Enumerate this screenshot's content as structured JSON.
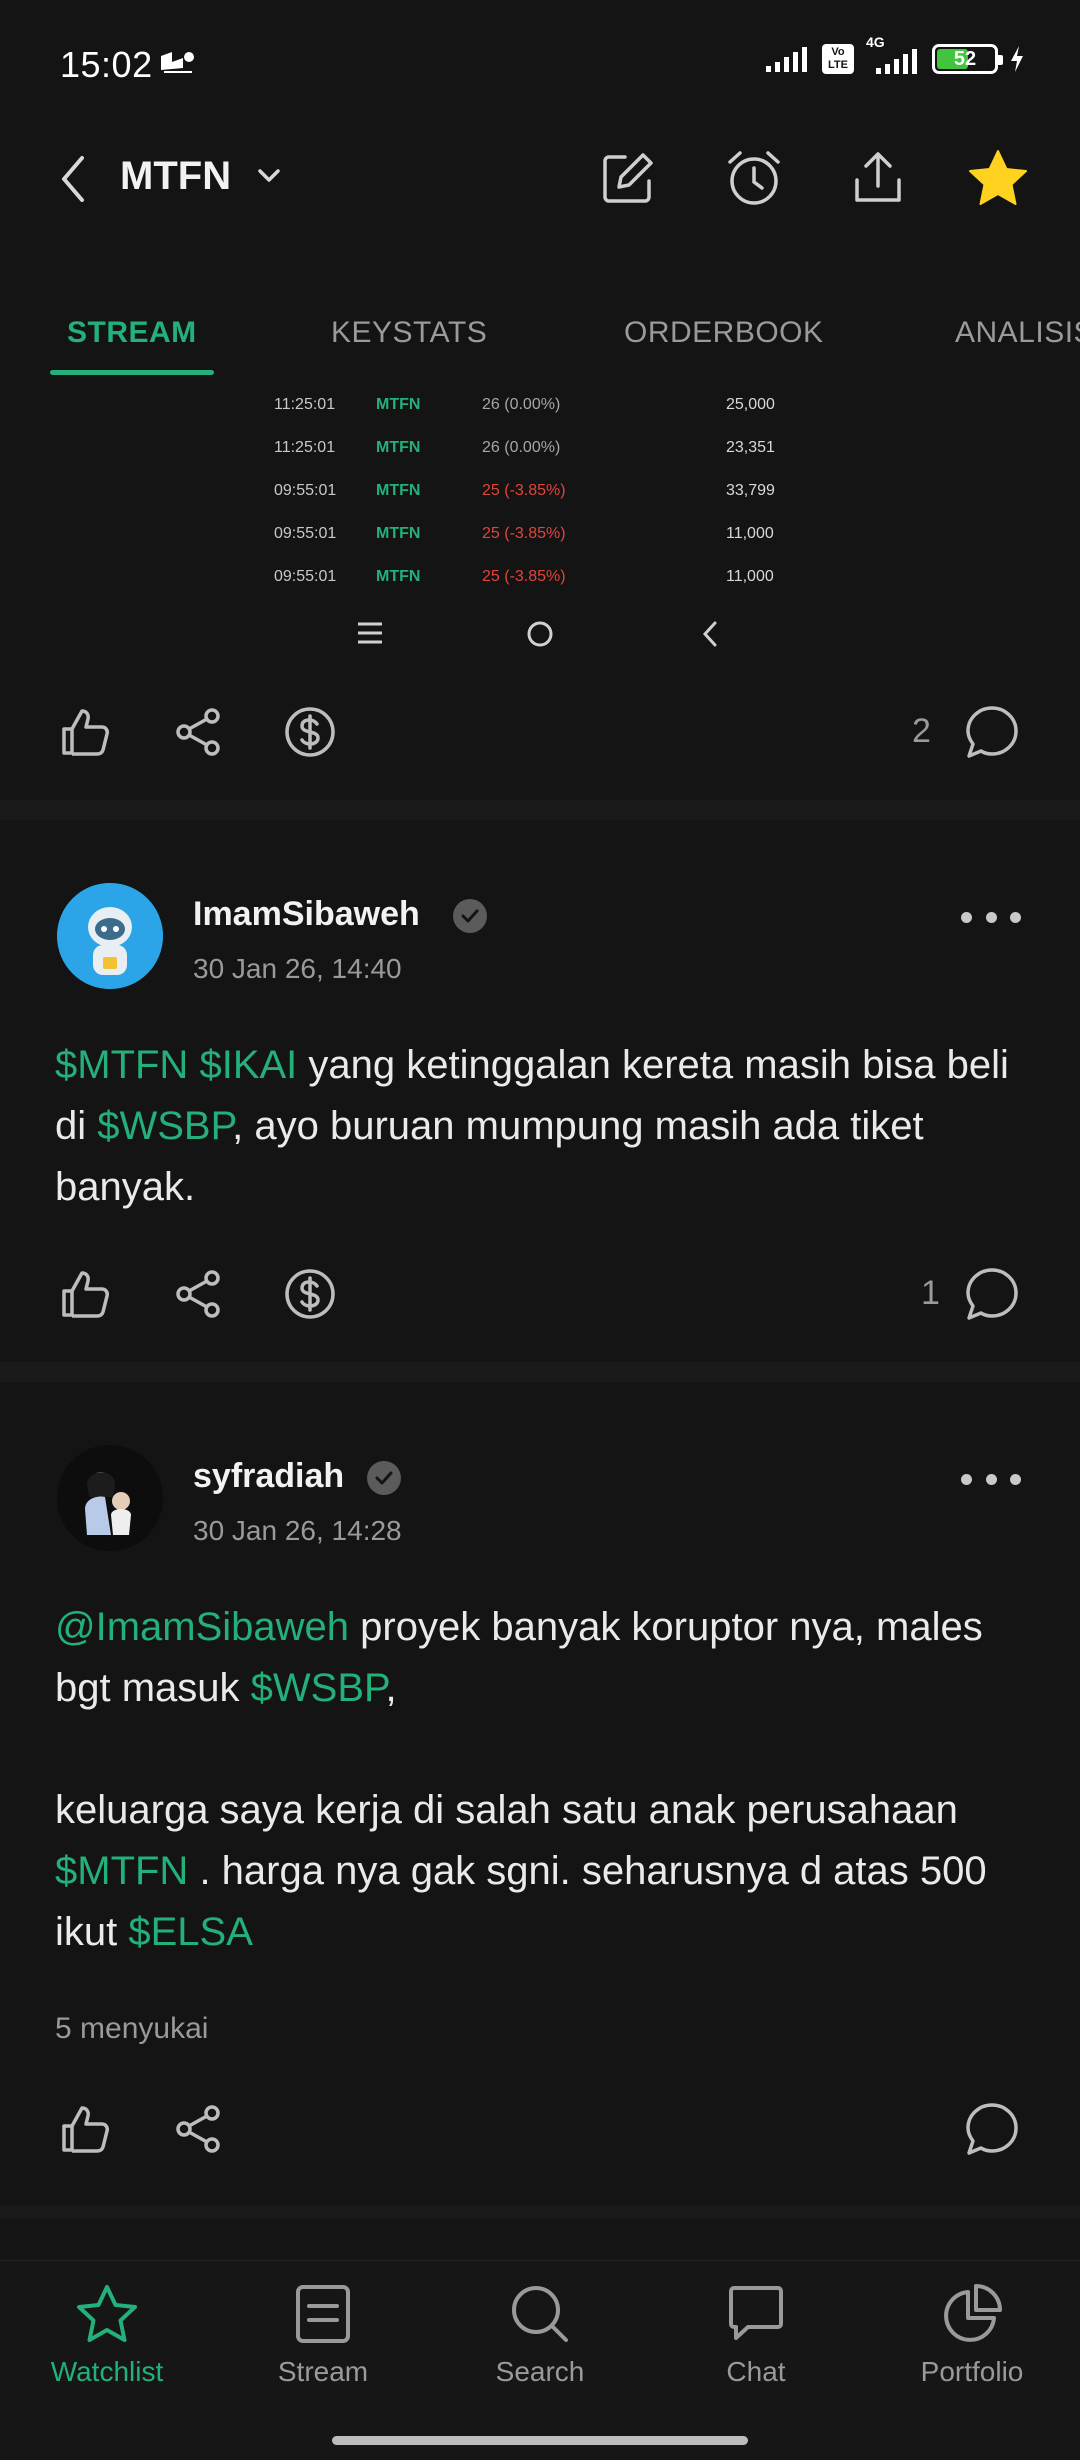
{
  "status_bar": {
    "time": "15:02",
    "battery": "52",
    "network": "4G",
    "volte": "Vo LTE"
  },
  "header": {
    "ticker": "MTFN"
  },
  "tabs": [
    {
      "label": "STREAM",
      "active": true
    },
    {
      "label": "KEYSTATS",
      "active": false
    },
    {
      "label": "ORDERBOOK",
      "active": false
    },
    {
      "label": "ANALISIS",
      "active": false
    }
  ],
  "trade_rows": [
    {
      "time": "11:25:01",
      "code": "MTFN",
      "price": "26 (0.00%)",
      "direction": "flat",
      "volume": "25,000"
    },
    {
      "time": "11:25:01",
      "code": "MTFN",
      "price": "26 (0.00%)",
      "direction": "flat",
      "volume": "23,351"
    },
    {
      "time": "09:55:01",
      "code": "MTFN",
      "price": "25 (-3.85%)",
      "direction": "down",
      "volume": "33,799"
    },
    {
      "time": "09:55:01",
      "code": "MTFN",
      "price": "25 (-3.85%)",
      "direction": "down",
      "volume": "11,000"
    },
    {
      "time": "09:55:01",
      "code": "MTFN",
      "price": "25 (-3.85%)",
      "direction": "down",
      "volume": "11,000"
    }
  ],
  "post0": {
    "comment_count": "2"
  },
  "post1": {
    "username": "ImamSibaweh",
    "timestamp": "30 Jan 26, 14:40",
    "text_tag1": "$MTFN",
    "text_tag2": "$IKAI",
    "text_part1": " yang ketinggalan kereta masih bisa beli di ",
    "text_tag3": "$WSBP",
    "text_part2": ", ayo buruan mumpung masih ada tiket banyak.",
    "comment_count": "1"
  },
  "post2": {
    "username": "syfradiah",
    "timestamp": "30 Jan 26, 14:28",
    "mention": "@ImamSibaweh",
    "text_part1": " proyek banyak koruptor nya, males bgt masuk ",
    "text_tag1": "$WSBP",
    "text_part2": ",",
    "text_part3": "keluarga saya kerja di salah satu anak perusahaan ",
    "text_tag2": "$MTFN",
    "text_part4": " . harga nya gak sgni. seharusnya d atas 500 ikut ",
    "text_tag3": "$ELSA",
    "likes": "5 menyukai"
  },
  "bottom_nav": [
    {
      "label": "Watchlist",
      "icon": "star-icon",
      "active": true
    },
    {
      "label": "Stream",
      "icon": "stream-icon",
      "active": false
    },
    {
      "label": "Search",
      "icon": "search-icon",
      "active": false
    },
    {
      "label": "Chat",
      "icon": "chat-icon",
      "active": false
    },
    {
      "label": "Portfolio",
      "icon": "pie-chart-icon",
      "active": false
    }
  ],
  "colors": {
    "accent": "#23b07a",
    "down": "#e0453c",
    "background": "#141414",
    "star": "#ffd21f"
  }
}
